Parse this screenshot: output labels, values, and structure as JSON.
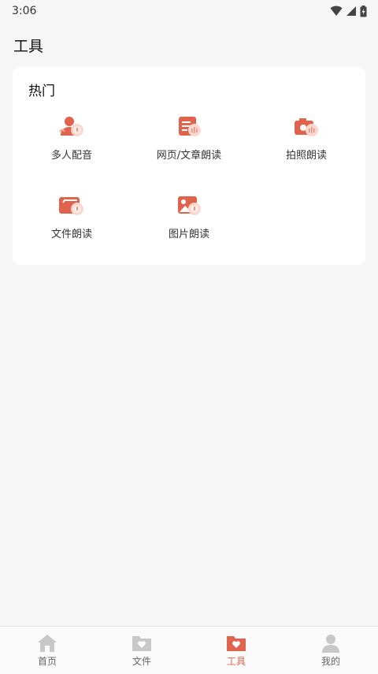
{
  "status_bar": {
    "time": "3:06"
  },
  "page": {
    "title": "工具"
  },
  "hot_section": {
    "heading": "热门",
    "tools": [
      {
        "label": "多人配音",
        "icon": "multi-voice-icon"
      },
      {
        "label": "网页/文章朗读",
        "icon": "article-read-icon"
      },
      {
        "label": "拍照朗读",
        "icon": "camera-read-icon"
      },
      {
        "label": "文件朗读",
        "icon": "file-read-icon"
      },
      {
        "label": "图片朗读",
        "icon": "image-read-icon"
      }
    ]
  },
  "tab_bar": {
    "tabs": [
      {
        "label": "首页",
        "icon": "home-icon",
        "active": false
      },
      {
        "label": "文件",
        "icon": "folder-heart-icon",
        "active": false
      },
      {
        "label": "工具",
        "icon": "folder-heart-icon",
        "active": true
      },
      {
        "label": "我的",
        "icon": "user-icon",
        "active": false
      }
    ]
  },
  "colors": {
    "accent": "#e0634e",
    "inactive": "#c8c8c8",
    "background": "#f6f6f6"
  }
}
